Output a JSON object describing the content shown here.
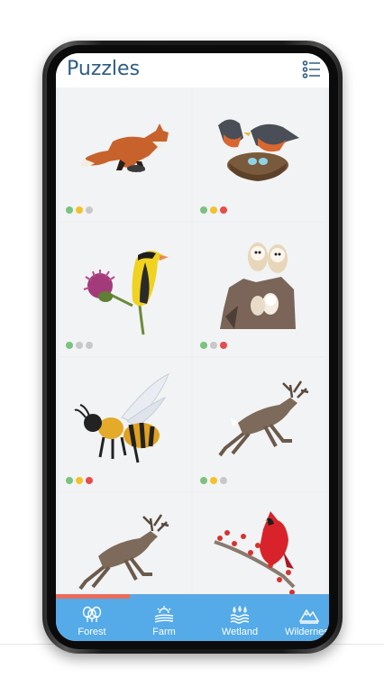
{
  "header": {
    "title": "Puzzles",
    "menu_icon": "list-icon"
  },
  "colors": {
    "title": "#2f5d86",
    "nav_background": "#55aae8",
    "progress_fill": "#ea6b5b",
    "dot_green": "#7cc27f",
    "dot_yellow": "#f2c12e",
    "dot_red": "#e74c4c",
    "dot_gray": "#c8c8c8"
  },
  "puzzles": [
    {
      "subject": "fox",
      "dots": [
        "green",
        "yellow",
        "gray"
      ]
    },
    {
      "subject": "robins-nest",
      "dots": [
        "green",
        "yellow",
        "red"
      ]
    },
    {
      "subject": "goldfinch-thistle",
      "dots": [
        "green",
        "gray",
        "gray"
      ]
    },
    {
      "subject": "barn-owls",
      "dots": [
        "green",
        "gray",
        "red"
      ]
    },
    {
      "subject": "bee",
      "dots": [
        "green",
        "yellow",
        "red"
      ]
    },
    {
      "subject": "deer-leaping",
      "dots": [
        "green",
        "yellow",
        "gray"
      ]
    },
    {
      "subject": "deer-leaping-2",
      "dots": []
    },
    {
      "subject": "cardinal-berries",
      "dots": []
    }
  ],
  "progress": {
    "fraction": 0.27
  },
  "nav": {
    "items": [
      {
        "label": "Forest",
        "icon": "forest-icon"
      },
      {
        "label": "Farm",
        "icon": "farm-icon"
      },
      {
        "label": "Wetland",
        "icon": "wetland-icon"
      },
      {
        "label": "Wilderness",
        "icon": "mountain-icon"
      }
    ]
  }
}
